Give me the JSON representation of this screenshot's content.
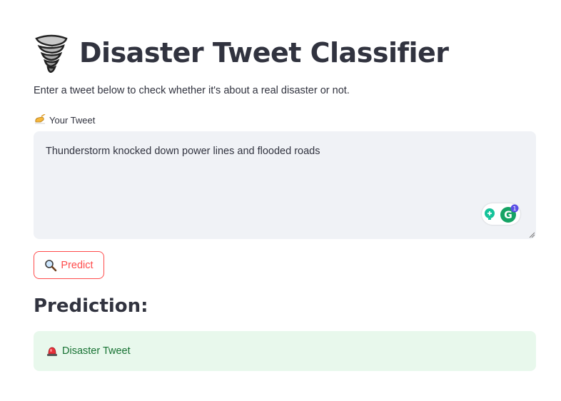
{
  "header": {
    "icon": "tornado-icon",
    "title": "Disaster Tweet Classifier"
  },
  "description": "Enter a tweet below to check whether it's about a real disaster or not.",
  "tweet_input": {
    "label_icon": "writing-hand-icon",
    "label": "Your Tweet",
    "value": "Thunderstorm knocked down power lines and flooded roads",
    "grammarly_badge_count": "1"
  },
  "predict_button": {
    "icon": "magnifier-icon",
    "label": "Predict"
  },
  "prediction": {
    "heading": "Prediction:",
    "result_icon": "siren-icon",
    "result_text": "Disaster Tweet"
  },
  "colors": {
    "primary": "#ff4b4b",
    "success_bg": "#e8f8ec",
    "success_text": "#177233",
    "input_bg": "#f0f2f6",
    "text": "#31333f"
  }
}
